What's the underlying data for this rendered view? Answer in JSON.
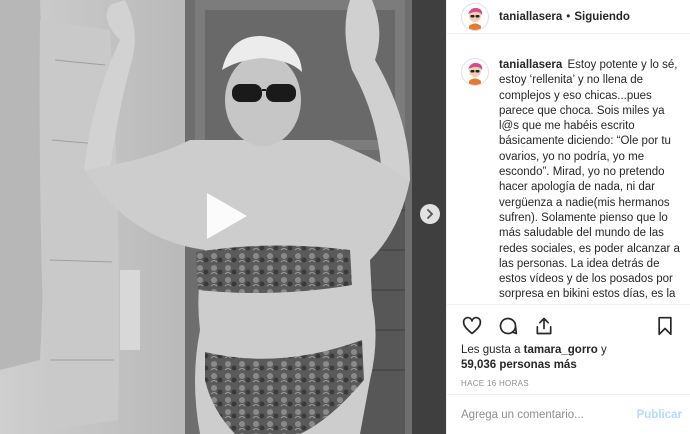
{
  "post": {
    "username": "taniallasera",
    "separator": "•",
    "follow_status": "Siguiendo",
    "caption": "Estoy potente y lo sé, estoy ‘rellenita’ y no llena de complejos y eso chicas...pues parece que choca. Sois miles ya l@s que me habéis escrito básicamente diciendo: “Ole por tu ovarios, yo no podría, yo me escondo”. Mirad, yo no pretendo hacer apología de nada, ni dar vergüenza a nadie(mis hermanos sufren). Solamente pienso que lo más saludable del mundo de las redes sociales, es poder alcanzar a las personas. La idea detrás de estos vídeos y de los posados por sorpresa en bikini estos días, es la de normalizar la celulitis y las mujeres de todos los tamaños. Lo saludable para tu alma es estar cómoda en tu piel, en tu cuerpo y a veces eso cuesta verlo",
    "likes_prefix": "Les gusta a",
    "likes_user": "tamara_gorro",
    "likes_join": "y",
    "likes_count": "59,036 personas más",
    "timestamp": "HACE 16 HORAS",
    "comment_placeholder": "Agrega un comentario...",
    "publish_label": "Publicar"
  },
  "icons": {
    "play": "play-icon",
    "next": "chevron-right-icon",
    "like": "heart-icon",
    "comment": "comment-icon",
    "share": "share-icon",
    "save": "bookmark-icon"
  },
  "colors": {
    "link_disabled": "#b3dbff",
    "muted": "#8e8e8e",
    "text": "#262626"
  }
}
